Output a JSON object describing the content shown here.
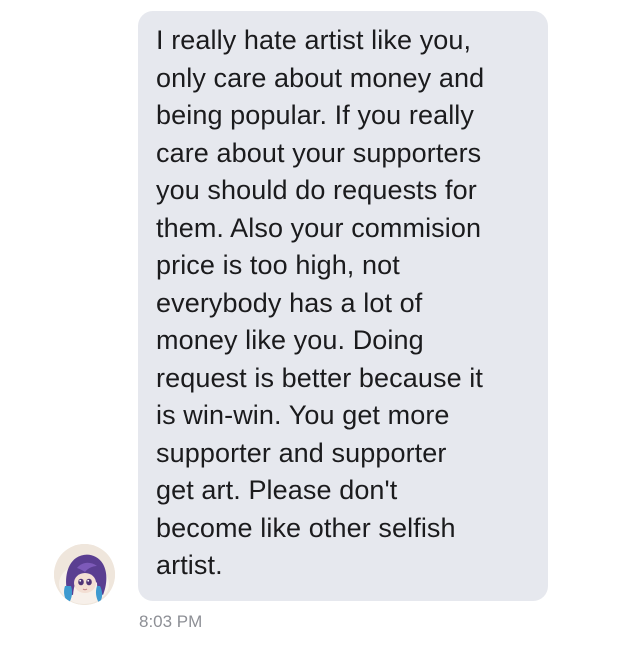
{
  "message": {
    "text": "I really hate artist like you,\nonly care about money and\nbeing popular. If you really\ncare about your supporters\nyou should do requests for\nthem. Also your commision\nprice is too high, not\neverybody has a lot of\nmoney like you. Doing\nrequest is better because it\nis win-win. You get more\nsupporter and supporter\nget art. Please don't\nbecome like other selfish\nartist.",
    "timestamp": "8:03 PM"
  },
  "sender": {
    "avatar_icon": "anime-avatar-icon"
  },
  "colors": {
    "bubble": "#e6e8ee",
    "text": "#1b1b1d",
    "timestamp": "#8d8f95",
    "background": "#ffffff"
  }
}
